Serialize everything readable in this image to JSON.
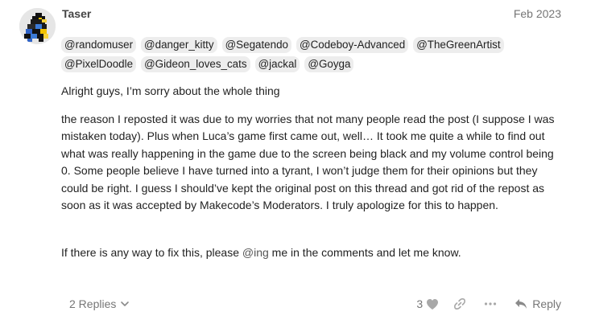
{
  "post": {
    "username": "Taser",
    "date": "Feb 2023",
    "mentions": [
      "@randomuser",
      "@danger_kitty",
      "@Segatendo",
      "@Codeboy-Advanced",
      "@TheGreenArtist",
      "@PixelDoodle",
      "@Gideon_loves_cats",
      "@jackal",
      "@Goyga"
    ],
    "paragraph1": "Alright guys, I’m sorry about the whole thing",
    "paragraph2": "the reason I reposted it was due to my worries that not many people read the post (I suppose I was mistaken today). Plus when Luca’s game first came out, well… It took me quite a while to find out what was really happening in the game due to the screen being black and my volume control being 0. Some people believe I have turned into a tyrant, I won’t judge them for their opinions but they could be right. I guess I should’ve kept the original post on this thread and got rid of the repost as soon as it was accepted by Makecode’s Moderators. I truly apologize for this to happen.",
    "paragraph3_before": "If there is any way to fix this, please ",
    "paragraph3_link": "@ing",
    "paragraph3_after": " me in the comments and let me know."
  },
  "footer": {
    "replies_label": "2 Replies",
    "like_count": "3",
    "reply_label": "Reply"
  },
  "icons": {
    "replies_toggle": "chevron-down-icon",
    "like": "heart-icon",
    "share": "link-icon",
    "more": "more-dots-icon",
    "reply": "reply-arrow-icon"
  },
  "colors": {
    "mention_bg": "#ededed",
    "muted_text": "#767676",
    "body_text": "#222222",
    "username": "#444444"
  }
}
